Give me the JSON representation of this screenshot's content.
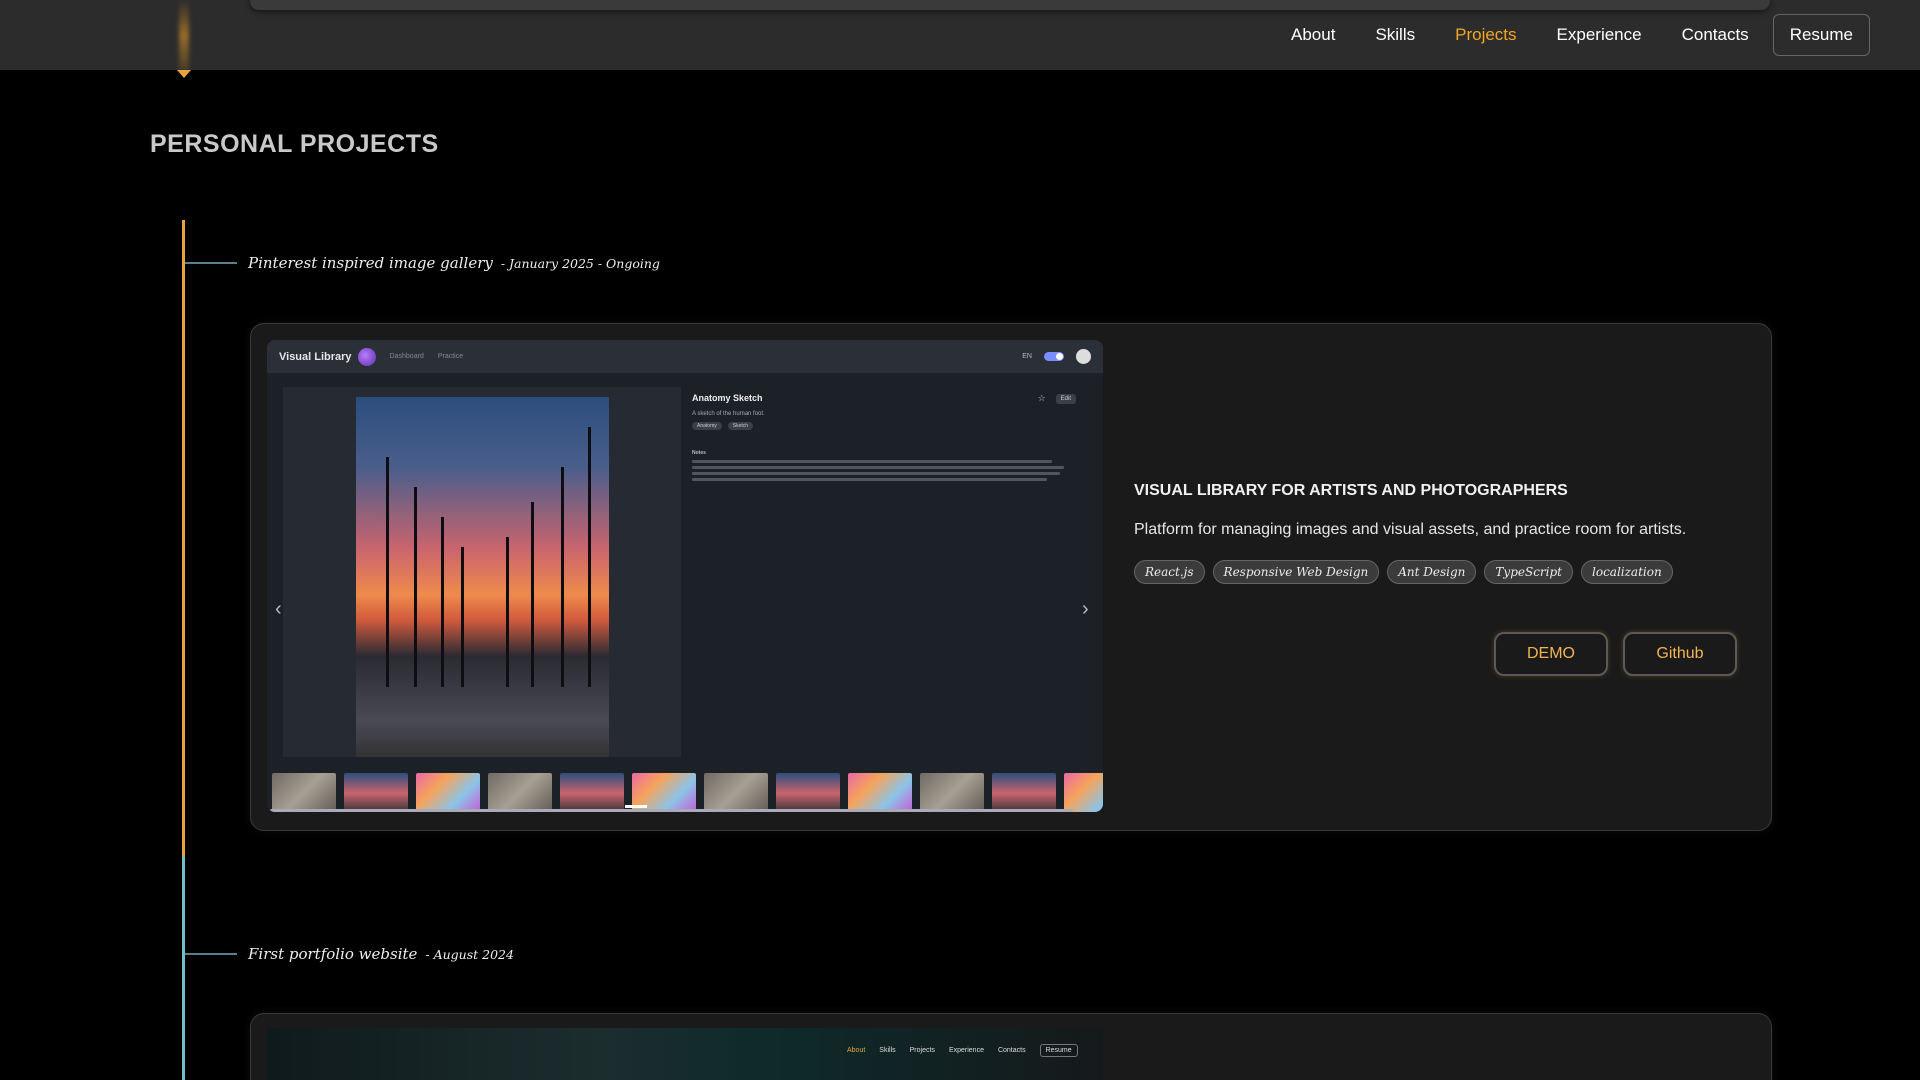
{
  "nav": {
    "links": [
      "About",
      "Skills",
      "Projects",
      "Experience",
      "Contacts"
    ],
    "active": "Projects",
    "resume_label": "Resume"
  },
  "section_title": "PERSONAL PROJECTS",
  "projects": [
    {
      "name": "Pinterest inspired image gallery",
      "date": "- January 2025 - Ongoing",
      "preview": {
        "brand": "Visual Library",
        "tabs": [
          "Dashboard",
          "Practice"
        ],
        "lang": "EN",
        "item_title": "Anatomy Sketch",
        "item_desc": "A sketch of the human foot.",
        "item_tags": [
          "Anatomy",
          "Sketch"
        ],
        "notes_label": "Notes",
        "edit_label": "Edit"
      },
      "title": "VISUAL LIBRARY FOR ARTISTS AND PHOTOGRAPHERS",
      "description": "Platform for managing images and visual assets, and practice room for artists.",
      "tags": [
        "React.js",
        "Responsive Web Design",
        "Ant Design",
        "TypeScript",
        "localization"
      ],
      "demo_label": "DEMO",
      "github_label": "Github"
    },
    {
      "name": "First portfolio website",
      "date": "- August 2024",
      "preview": {
        "links": [
          "About",
          "Skills",
          "Projects",
          "Experience",
          "Contacts"
        ],
        "resume_label": "Resume"
      }
    }
  ],
  "colors": {
    "accent": "#f5a623",
    "timeline_current": "#e8a33c",
    "timeline_past": "#6fc1c9",
    "card_bg": "#1a1a1a"
  },
  "icons": [
    "chevron-left-icon",
    "chevron-right-icon",
    "star-icon",
    "avatar-icon"
  ]
}
